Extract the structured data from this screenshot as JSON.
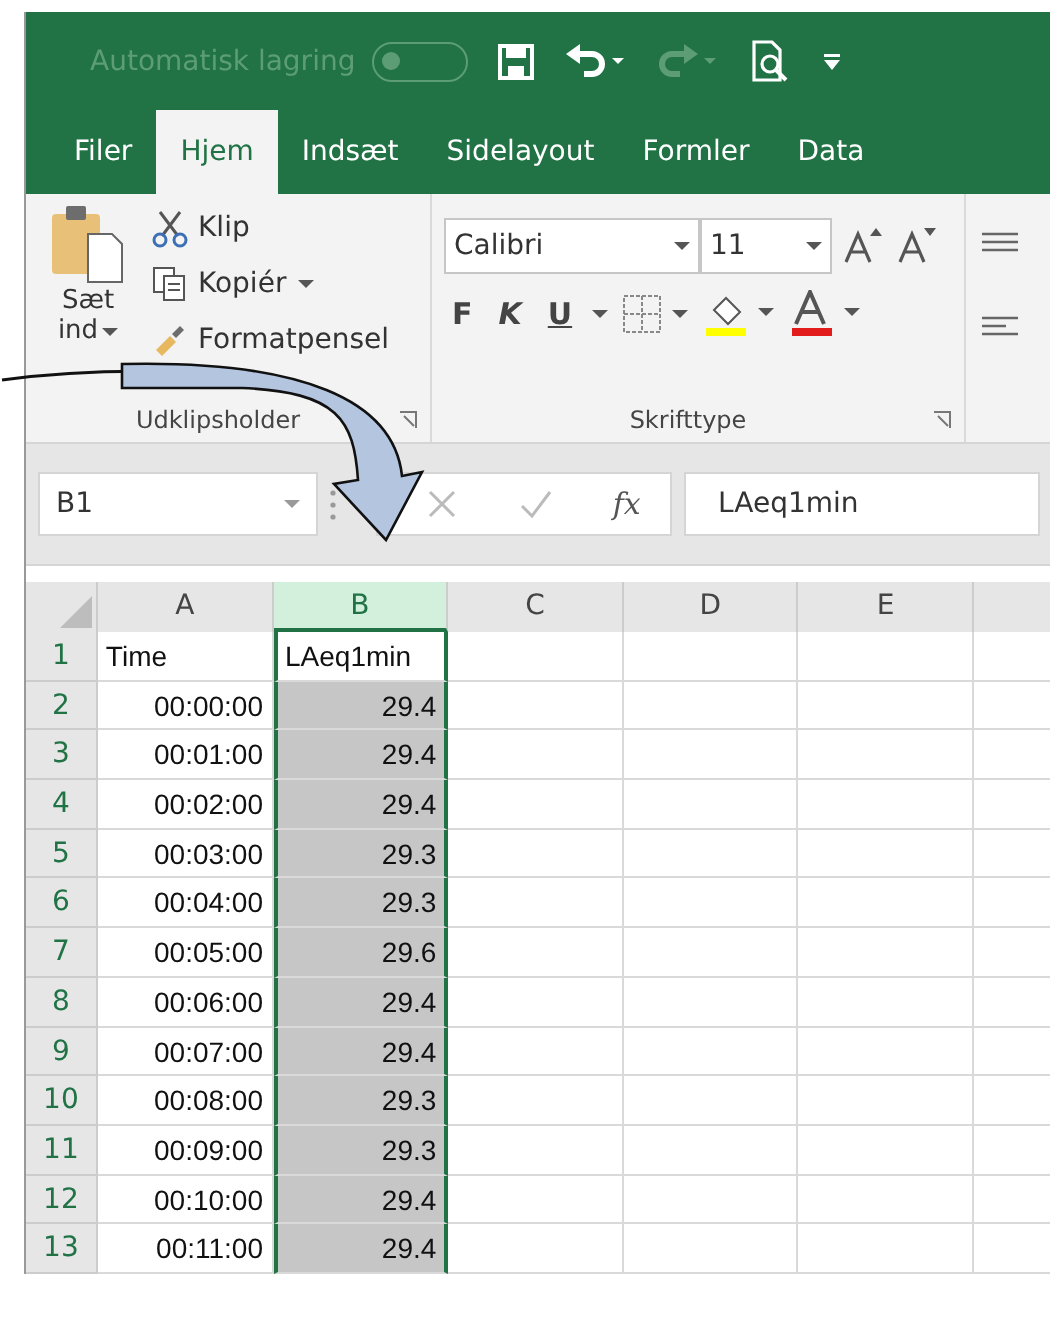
{
  "quick_access": {
    "autosave_label": "Automatisk lagring",
    "autosave_on": false
  },
  "tabs": [
    {
      "label": "Filer",
      "selected": false
    },
    {
      "label": "Hjem",
      "selected": true
    },
    {
      "label": "Indsæt",
      "selected": false
    },
    {
      "label": "Sidelayout",
      "selected": false
    },
    {
      "label": "Formler",
      "selected": false
    },
    {
      "label": "Data",
      "selected": false
    }
  ],
  "clipboard": {
    "paste_line1": "Sæt",
    "paste_line2": "ind",
    "commands": [
      "Klip",
      "Kopiér",
      "Formatpensel"
    ],
    "group_label": "Udklipsholder"
  },
  "font": {
    "font_name": "Calibri",
    "font_size": "11",
    "bold": "F",
    "italic": "K",
    "underline": "U",
    "group_label": "Skrifttype"
  },
  "formula_bar": {
    "name_box": "B1",
    "fx": "fx",
    "value": "LAeq1min"
  },
  "columns": [
    {
      "label": "A",
      "selected": false
    },
    {
      "label": "B",
      "selected": true
    },
    {
      "label": "C",
      "selected": false
    },
    {
      "label": "D",
      "selected": false
    },
    {
      "label": "E",
      "selected": false
    }
  ],
  "rows": [
    {
      "number": "1",
      "cells": [
        "Time",
        "LAeq1min"
      ]
    },
    {
      "number": "2",
      "cells": [
        "00:00:00",
        "29.4"
      ]
    },
    {
      "number": "3",
      "cells": [
        "00:01:00",
        "29.4"
      ]
    },
    {
      "number": "4",
      "cells": [
        "00:02:00",
        "29.4"
      ]
    },
    {
      "number": "5",
      "cells": [
        "00:03:00",
        "29.3"
      ]
    },
    {
      "number": "6",
      "cells": [
        "00:04:00",
        "29.3"
      ]
    },
    {
      "number": "7",
      "cells": [
        "00:05:00",
        "29.6"
      ]
    },
    {
      "number": "8",
      "cells": [
        "00:06:00",
        "29.4"
      ]
    },
    {
      "number": "9",
      "cells": [
        "00:07:00",
        "29.4"
      ]
    },
    {
      "number": "10",
      "cells": [
        "00:08:00",
        "29.3"
      ]
    },
    {
      "number": "11",
      "cells": [
        "00:09:00",
        "29.3"
      ]
    },
    {
      "number": "12",
      "cells": [
        "00:10:00",
        "29.4"
      ]
    },
    {
      "number": "13",
      "cells": [
        "00:11:00",
        "29.4"
      ]
    }
  ]
}
